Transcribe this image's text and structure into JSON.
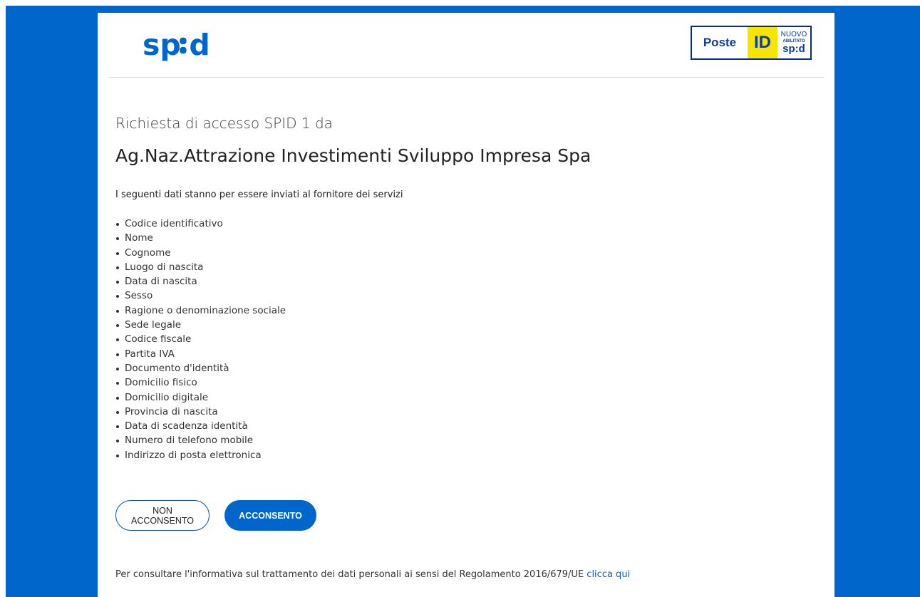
{
  "header": {
    "spid_logo_text": "sp:d",
    "badge": {
      "poste": "Poste",
      "id": "ID",
      "nuovo": "NUOVO",
      "abilitato": "ABILITATO",
      "spid": "sp:d"
    }
  },
  "request": {
    "subtitle": "Richiesta di accesso SPID 1 da",
    "provider": "Ag.Naz.Attrazione Investimenti Sviluppo Impresa Spa",
    "intro": "I seguenti dati stanno per essere inviati al fornitore dei servizi"
  },
  "attributes": [
    "Codice identificativo",
    "Nome",
    "Cognome",
    "Luogo di nascita",
    "Data di nascita",
    "Sesso",
    "Ragione o denominazione sociale",
    "Sede legale",
    "Codice fiscale",
    "Partita IVA",
    "Documento d'identità",
    "Domicilio fisico",
    "Domicilio digitale",
    "Provincia di nascita",
    "Data di scadenza identità",
    "Numero di telefono mobile",
    "Indirizzo di posta elettronica"
  ],
  "actions": {
    "deny_label": "NON ACCONSENTO",
    "accept_label": "ACCONSENTO"
  },
  "footer": {
    "text": "Per consultare l'informativa sul trattamento dei dati personali ai sensi del Regolamento 2016/679/UE ",
    "link_label": "clicca qui"
  },
  "colors": {
    "brand_blue": "#0066cc",
    "badge_yellow": "#f6e500",
    "link_blue": "#0b5fc1"
  }
}
